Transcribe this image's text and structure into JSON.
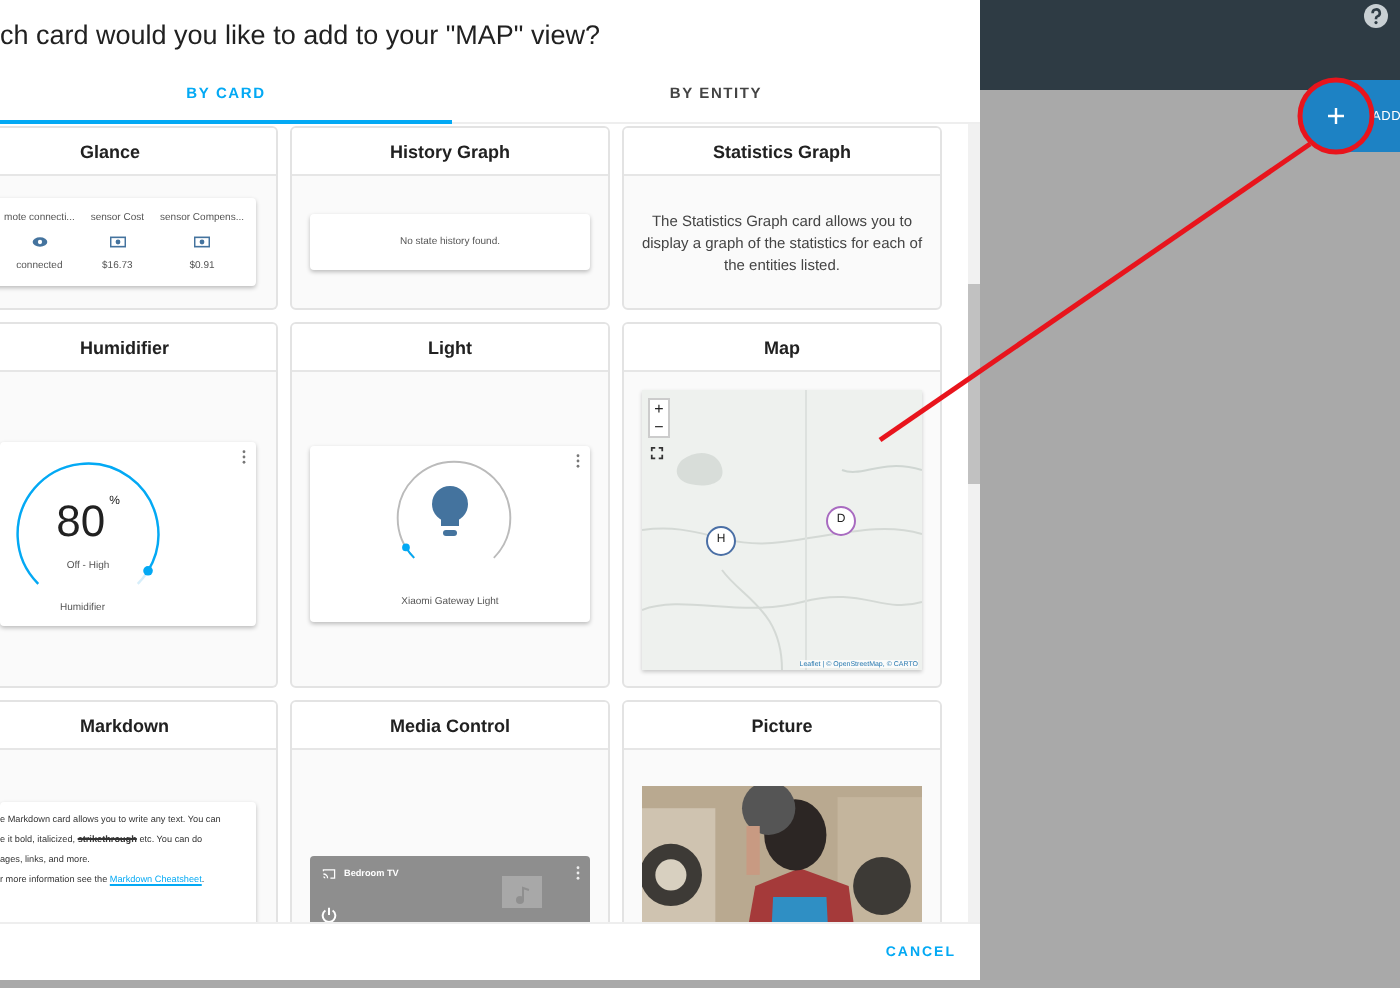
{
  "dialog": {
    "title": "ch card would you like to add to your \"MAP\" view?",
    "tabs": [
      {
        "label": "BY CARD",
        "selected": true
      },
      {
        "label": "BY ENTITY",
        "selected": false
      }
    ],
    "cards": [
      {
        "kind": "glance",
        "title": "Glance",
        "entities": [
          {
            "name": "mote connecti...",
            "value": "connected"
          },
          {
            "name": "sensor Cost",
            "value": "$16.73"
          },
          {
            "name": "sensor Compens...",
            "value": "$0.91"
          }
        ]
      },
      {
        "kind": "history",
        "title": "History Graph",
        "message": "No state history found."
      },
      {
        "kind": "text",
        "title": "Statistics Graph",
        "text": "The Statistics Graph card allows you to display a graph of the statistics for each of the entities listed."
      },
      {
        "kind": "humidifier",
        "title": "Humidifier",
        "value": "80",
        "unit": "%",
        "mode": "Off - High",
        "name": "Humidifier",
        "level": 0.95
      },
      {
        "kind": "light",
        "title": "Light",
        "name": "Xiaomi Gateway Light",
        "level": 0.05
      },
      {
        "kind": "map",
        "title": "Map",
        "zoom_in": "+",
        "zoom_out": "−",
        "markers": [
          {
            "label": "H",
            "color": "#4a6fa5"
          },
          {
            "label": "D",
            "color": "#a86bc0"
          }
        ],
        "attribution": "Leaflet | © OpenStreetMap, © CARTO"
      },
      {
        "kind": "markdown",
        "title": "Markdown",
        "lines": [
          [
            {
              "text": "e Markdown card allows you to write any text. You can",
              "kind": "plain"
            }
          ],
          [
            {
              "text": "e it bold, italicized, ",
              "kind": "plain"
            },
            {
              "text": "strikethrough",
              "kind": "strike"
            },
            {
              "text": " etc. You can do",
              "kind": "plain"
            }
          ],
          [
            {
              "text": "ages, links, and more.",
              "kind": "plain"
            }
          ],
          [
            {
              "text": "r more information see the ",
              "kind": "plain"
            },
            {
              "text": "Markdown Cheatsheet",
              "kind": "link"
            },
            {
              "text": ".",
              "kind": "plain"
            }
          ]
        ]
      },
      {
        "kind": "media",
        "title": "Media Control",
        "name": "Bedroom TV"
      },
      {
        "kind": "picture",
        "title": "Picture"
      }
    ],
    "buttons": [
      {
        "label": "CANCEL"
      }
    ]
  },
  "toolbar": {
    "add_button": "ADD"
  }
}
